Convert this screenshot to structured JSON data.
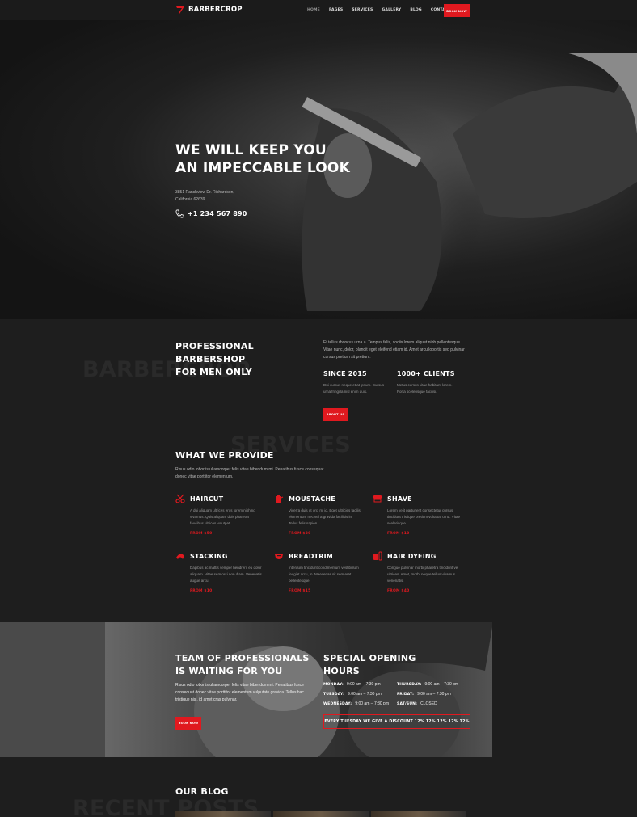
{
  "nav": {
    "brand": "BARBERCROP",
    "items": [
      "HOME",
      "PAGES",
      "SERVICES",
      "GALLERY",
      "BLOG",
      "CONTACTS"
    ],
    "cta": "BOOK NOW"
  },
  "hero": {
    "title_line1": "WE WILL KEEP YOU",
    "title_line2": "AN IMPECCABLE LOOK",
    "address_line1": "3851 Ranchview Dr. Richardson,",
    "address_line2": "California 62639",
    "phone": "+1 234 567 890"
  },
  "about": {
    "bg_word": "BARBERCROP",
    "title_line1": "PROFESSIONAL BARBERSHOP",
    "title_line2": "FOR MEN ONLY",
    "text": "Et tellus rhoncus urna a. Tempus felis, sociis lorem aliquet nibh pellentesque. Vitae nunc, dolor, blandit eget eleifend etiam id. Amet arcu lobortis sed pulvinar cursus pretium sit pretium.",
    "stats": [
      {
        "title": "SINCE 2015",
        "text": "Dui cursus neque et at ipsum. Cursus urna fringilla nisl enim duis."
      },
      {
        "title": "1000+ CLIENTS",
        "text": "Metus cursus vitae habitant lorem. Porta scelerisque facilisi."
      }
    ],
    "button": "ABOUT US"
  },
  "services": {
    "bg_word": "SERVICES",
    "title": "WHAT WE PROVIDE",
    "subtitle": "Risus odio lobortis ullamcorper felis vitae bibendum mi. Penatibus fusce consequat donec vitae porttitor elementum.",
    "items": [
      {
        "name": "HAIRCUT",
        "icon": "scissors-icon",
        "desc": "A dui aliquam ultrices eros lorem nibhing vivamus. Quis aliquam duis pharetra faucibus ultrices volutpat.",
        "price": "FROM $50"
      },
      {
        "name": "MOUSTACHE",
        "icon": "moustache-icon",
        "desc": "Viverra duis ut orci mi id. Eget ultricies facilisi elementum nec vel a gravida facilisis in. Tellus felis sapien.",
        "price": "FROM $30"
      },
      {
        "name": "SHAVE",
        "icon": "razor-icon",
        "desc": "Lorem velit parturient consectetur cursus tincidunt tristique pretium volutpat urna. Vitae scelerisque.",
        "price": "FROM $10"
      },
      {
        "name": "STACKING",
        "icon": "comb-icon",
        "desc": "Dapibus ac mattis semper hendrerit eu dolor aliquam. Vitae sem orci non diam. Venenatis augue arcu.",
        "price": "FROM $10"
      },
      {
        "name": "BREADTRIM",
        "icon": "beard-icon",
        "desc": "Interdum tincidunt condimentum vestibulum feugiat arcu, in. Maecenas sit sem erat pellentesque.",
        "price": "FROM $15"
      },
      {
        "name": "HAIR DYEING",
        "icon": "dye-icon",
        "desc": "Congue pulvinar morbi pharetra tincidunt vel ultrices. Amet, morbi neque tellus vivamus venenatis.",
        "price": "FROM $40"
      }
    ]
  },
  "team": {
    "title_line1": "TEAM OF PROFESSIONALS",
    "title_line2": "IS WAITING FOR YOU",
    "text": "Risus odio lobortis ullamcorper felis vitae bibendum mi. Penatibus fusce consequat donec vitae porttitor elementum vulputate gravida. Tellus hac tristique nisi, id amet cras pulvinar.",
    "button": "BOOK NOW"
  },
  "hours": {
    "title_line1": "SPECIAL OPENING",
    "title_line2": "HOURS",
    "rows": [
      {
        "day": "MONDAY:",
        "time": "9:00 am – 7:30 pm"
      },
      {
        "day": "TUESDAY:",
        "time": "9:00 am – 7:30 pm"
      },
      {
        "day": "WEDNESDAY:",
        "time": "9:00 am – 7:30 pm"
      },
      {
        "day": "THURSDAY:",
        "time": "9:00 am – 7:30 pm"
      },
      {
        "day": "FRIDAY:",
        "time": "9:00 am – 7:30 pm"
      },
      {
        "day": "SAT/SUN:",
        "time": "CLOSED"
      }
    ],
    "discount": "EVERY TUESDAY WE GIVE A DISCOUNT  12%  12%  12%  12%  12%"
  },
  "blog": {
    "bg_word": "RECENT POSTS",
    "title": "OUR BLOG"
  },
  "colors": {
    "accent": "#e0191f",
    "background": "#1e1e1e"
  }
}
